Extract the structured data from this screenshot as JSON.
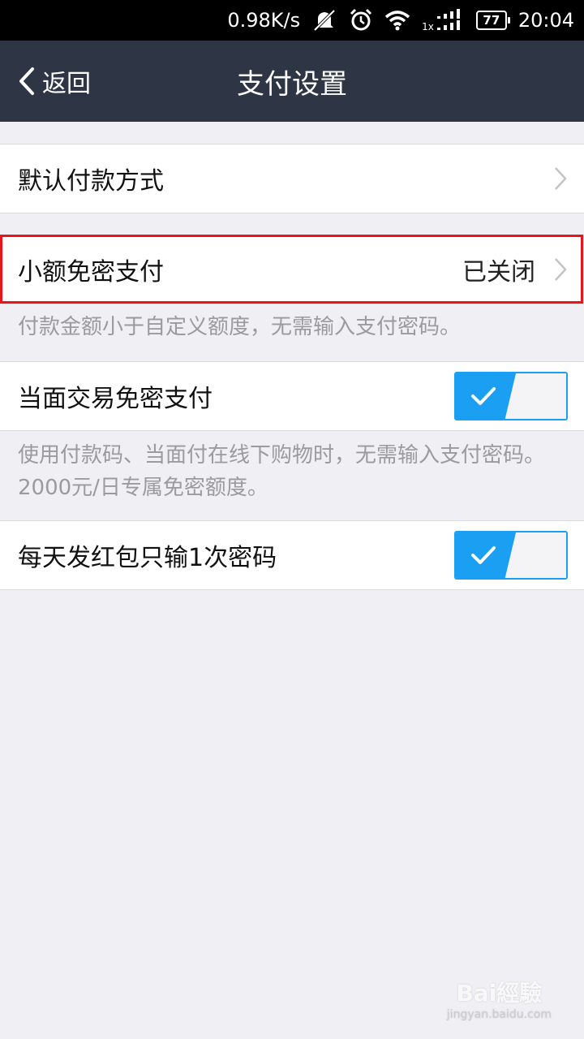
{
  "status_bar": {
    "speed": "0.98K/s",
    "sim_label": "1x",
    "battery": "77",
    "time": "20:04",
    "icons": [
      "mute-icon",
      "alarm-icon",
      "wifi-icon",
      "signal-icon",
      "battery-icon"
    ]
  },
  "nav": {
    "back_label": "返回",
    "title": "支付设置"
  },
  "rows": {
    "default_payment": {
      "label": "默认付款方式"
    },
    "small_free": {
      "label": "小额免密支付",
      "value": "已关闭",
      "hint": "付款金额小于自定义额度，无需输入支付密码。"
    },
    "face_to_face": {
      "label": "当面交易免密支付",
      "enabled": true,
      "hint": "使用付款码、当面付在线下购物时，无需输入支付密码。2000元/日专属免密额度。"
    },
    "red_packet": {
      "label": "每天发红包只输1次密码",
      "enabled": true
    }
  },
  "colors": {
    "nav_bg": "#2e3645",
    "toggle_on": "#1a9ff2",
    "highlight": "#e8161b"
  },
  "watermark": {
    "brand": "Bai經驗",
    "url": "jingyan.baidu.com"
  }
}
